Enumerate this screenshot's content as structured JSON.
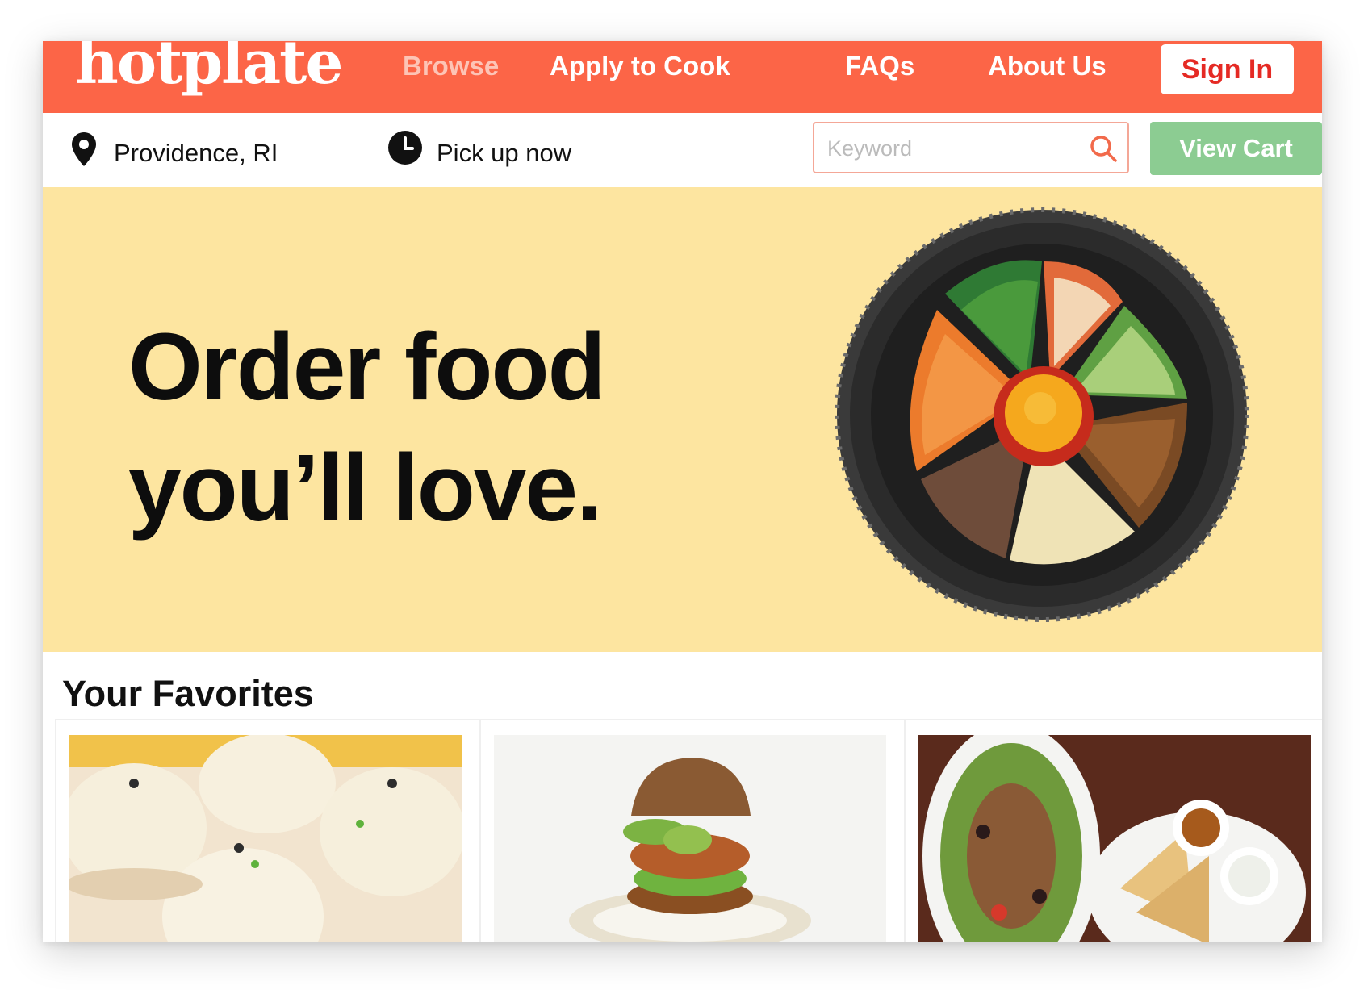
{
  "header": {
    "logo": "hotplate",
    "nav": [
      {
        "label": "Browse"
      },
      {
        "label": "Apply to Cook"
      },
      {
        "label": "FAQs"
      },
      {
        "label": "About Us"
      }
    ],
    "sign_in": "Sign In"
  },
  "subbar": {
    "location": "Providence, RI",
    "location_icon": "map-pin-icon",
    "pickup": "Pick up now",
    "pickup_icon": "clock-icon",
    "search_placeholder": "Keyword",
    "search_icon": "search-icon",
    "view_cart": "View Cart"
  },
  "hero": {
    "line1": "Order food",
    "line2": "you’ll love."
  },
  "favorites": {
    "title": "Your Favorites"
  },
  "colors": {
    "brand": "#fc6547",
    "hero_bg": "#fde5a0",
    "cart_green": "#8ccc92",
    "sign_in_red": "#e52a24"
  }
}
